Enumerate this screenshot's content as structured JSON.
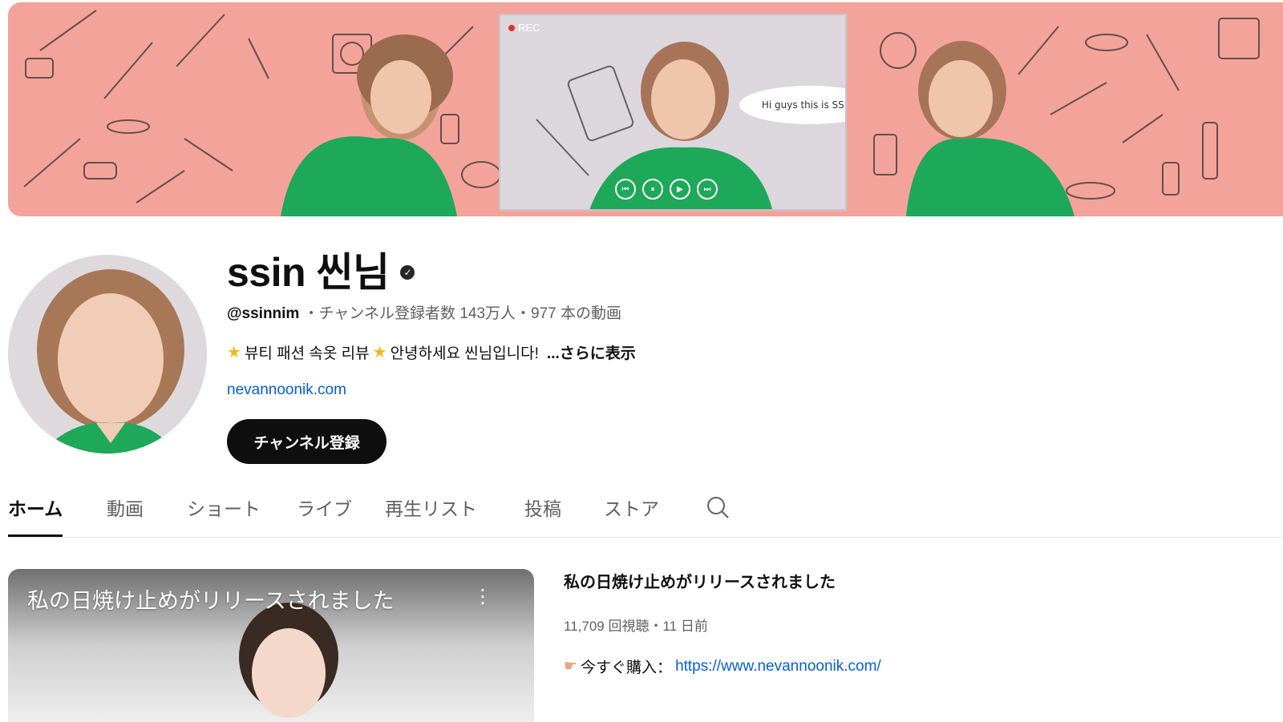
{
  "banner": {
    "rec_label": "REC",
    "speech_text": "Hi guys this is SSIN!",
    "background_color": "#f4a39a",
    "accent_color": "#1ea85a"
  },
  "channel": {
    "name": "ssin 씬님",
    "verified_icon": "check-circle-icon",
    "handle": "@ssinnim",
    "stats": "・チャンネル登録者数 143万人・977 本の動画",
    "description": "뷰티 패션 속옷 리뷰",
    "description_greeting": "안녕하세요 씬님입니다!",
    "description_more": "...さらに表示",
    "link": "nevannoonik.com",
    "subscribe_label": "チャンネル登録"
  },
  "tabs": [
    {
      "label": "ホーム",
      "active": true
    },
    {
      "label": "動画",
      "active": false
    },
    {
      "label": "ショート",
      "active": false
    },
    {
      "label": "ライブ",
      "active": false
    },
    {
      "label": "再生リスト",
      "active": false
    },
    {
      "label": "投稿",
      "active": false
    },
    {
      "label": "ストア",
      "active": false
    }
  ],
  "featured_video": {
    "thumbnail_title": "私の日焼け止めがリリースされました",
    "title": "私の日焼け止めがリリースされました",
    "meta": "11,709 回視聴・11 日前",
    "description_prefix": "今すぐ購入：",
    "description_url": "https://www.nevannoonik.com/"
  }
}
